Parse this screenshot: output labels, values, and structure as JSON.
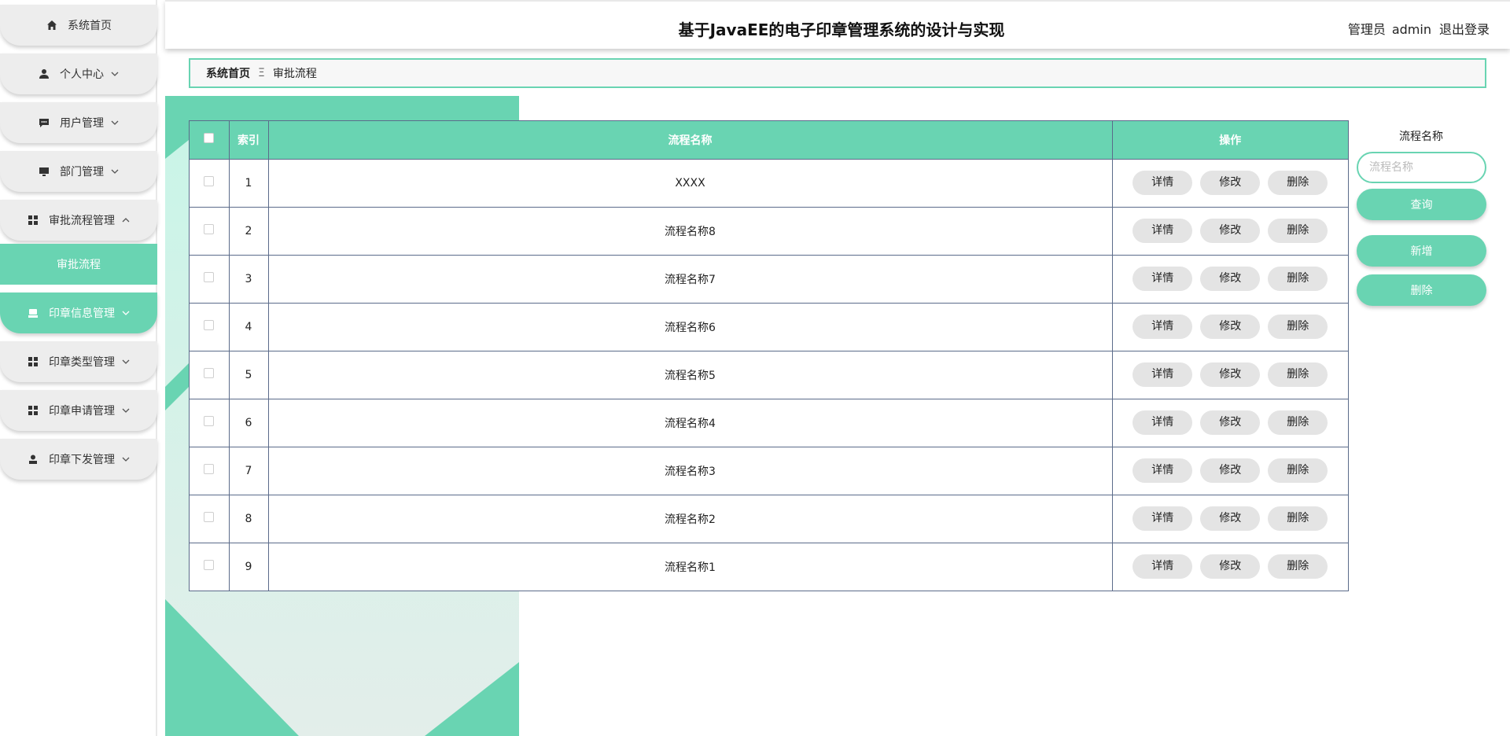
{
  "header": {
    "title": "基于JavaEE的电子印章管理系统的设计与实现",
    "role": "管理员",
    "username": "admin",
    "logout": "退出登录"
  },
  "sidebar": {
    "items": [
      {
        "label": "系统首页",
        "icon": "home-icon"
      },
      {
        "label": "个人中心",
        "icon": "user-icon"
      },
      {
        "label": "用户管理",
        "icon": "chat-icon"
      },
      {
        "label": "部门管理",
        "icon": "monitor-icon"
      },
      {
        "label": "审批流程管理",
        "icon": "grid-icon"
      },
      {
        "label": "印章信息管理",
        "icon": "stamp-icon"
      },
      {
        "label": "印章类型管理",
        "icon": "grid-icon"
      },
      {
        "label": "印章申请管理",
        "icon": "grid-icon"
      },
      {
        "label": "印章下发管理",
        "icon": "person-icon"
      }
    ],
    "submenu_active": "审批流程"
  },
  "breadcrumb": {
    "home": "系统首页",
    "separator": "Ξ",
    "current": "审批流程"
  },
  "table": {
    "columns": [
      "索引",
      "流程名称",
      "操作"
    ],
    "rows": [
      {
        "index": "1",
        "name": "XXXX"
      },
      {
        "index": "2",
        "name": "流程名称8"
      },
      {
        "index": "3",
        "name": "流程名称7"
      },
      {
        "index": "4",
        "name": "流程名称6"
      },
      {
        "index": "5",
        "name": "流程名称5"
      },
      {
        "index": "6",
        "name": "流程名称4"
      },
      {
        "index": "7",
        "name": "流程名称3"
      },
      {
        "index": "8",
        "name": "流程名称2"
      },
      {
        "index": "9",
        "name": "流程名称1"
      }
    ],
    "actions": {
      "detail": "详情",
      "edit": "修改",
      "delete": "删除"
    }
  },
  "search": {
    "label": "流程名称",
    "placeholder": "流程名称",
    "value": "",
    "query_btn": "查询",
    "add_btn": "新增",
    "delete_btn": "删除"
  },
  "colors": {
    "accent": "#69d4b2",
    "border": "#5b6b8a",
    "button_gray": "#e4e4e4"
  }
}
